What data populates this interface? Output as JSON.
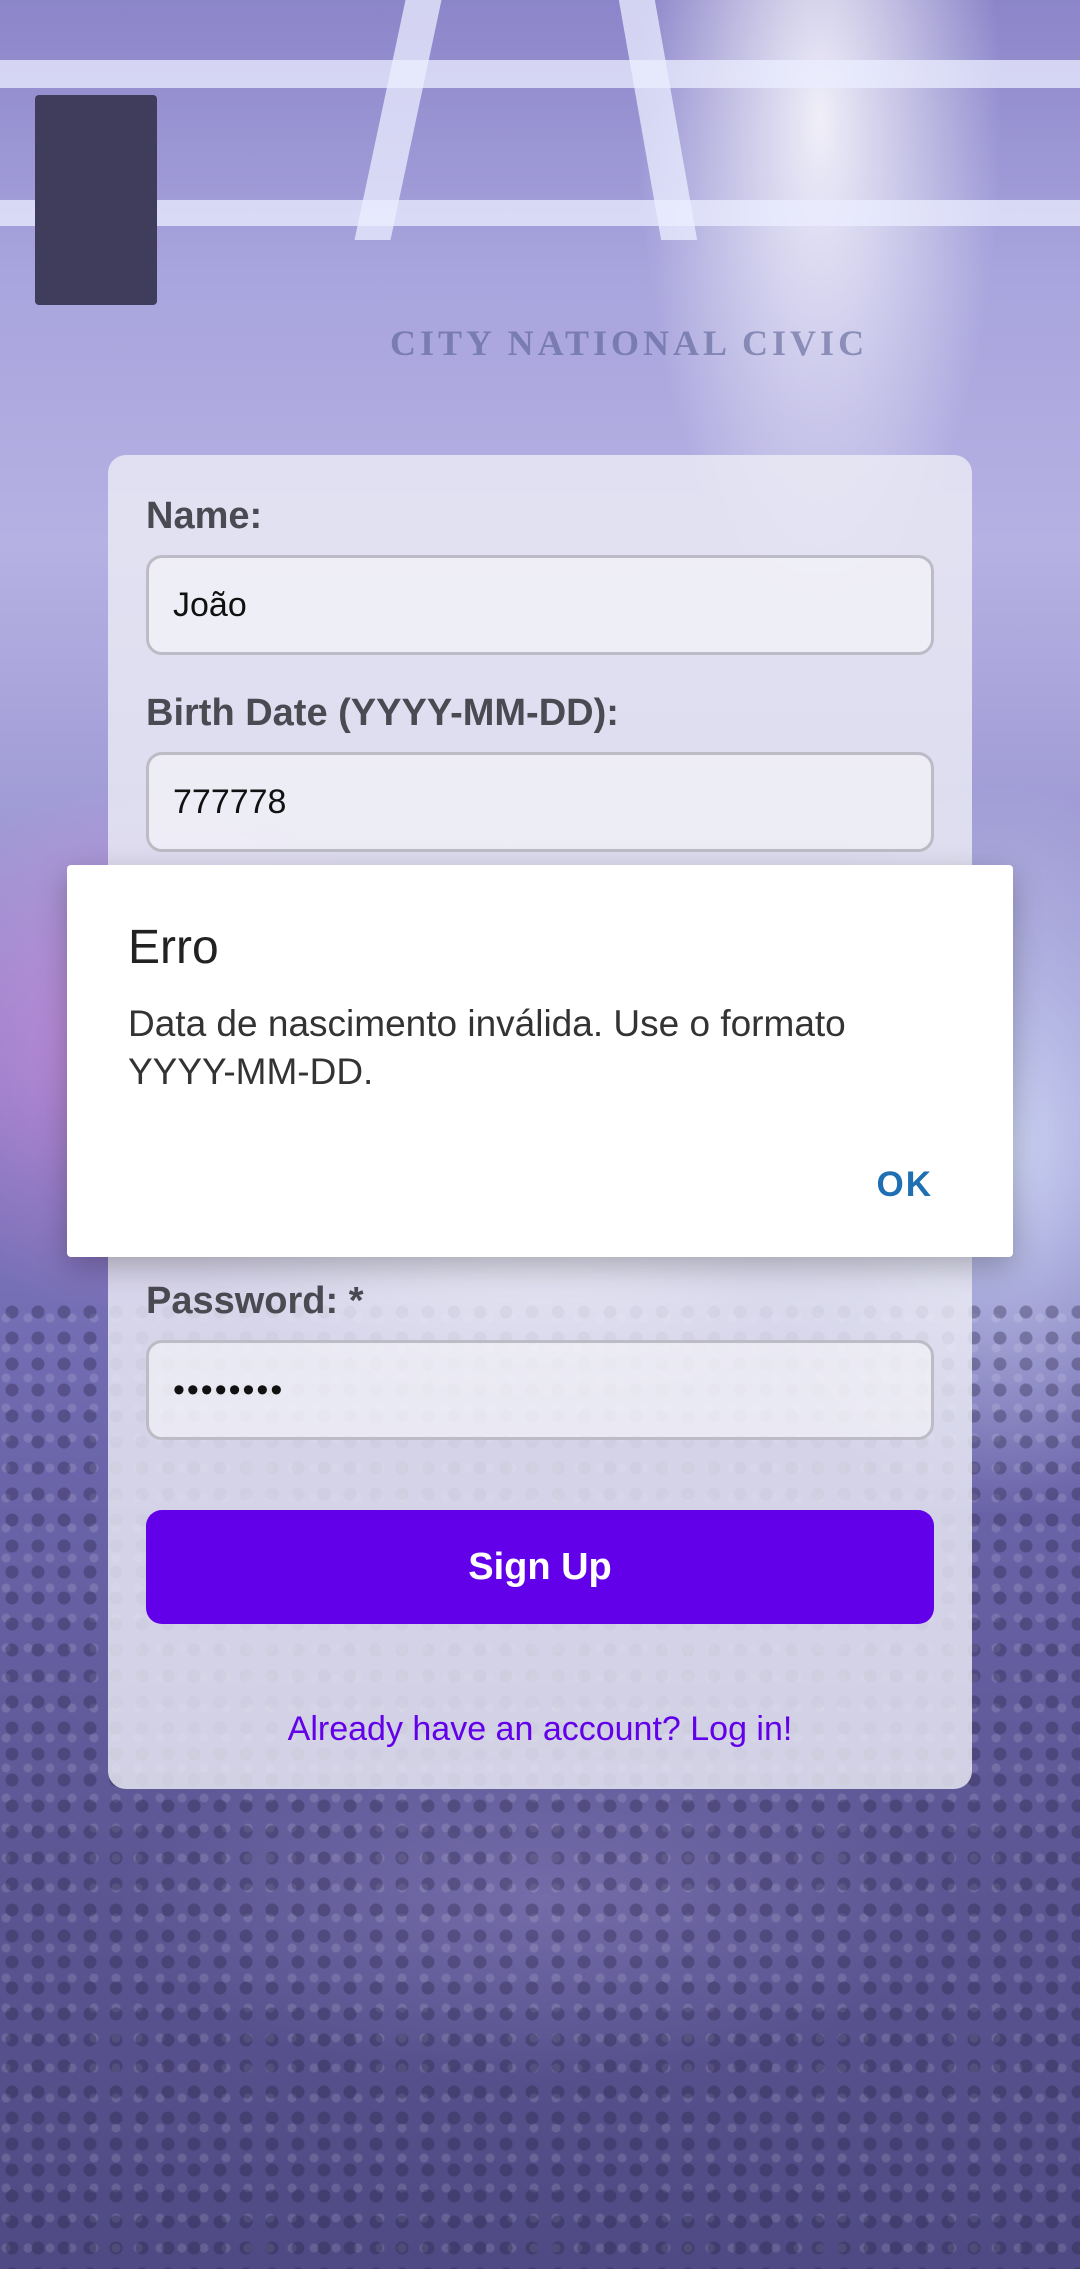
{
  "background": {
    "venue_sign": "CITY NATIONAL CIVIC"
  },
  "form": {
    "name_label": "Name:",
    "name_value": "João",
    "birth_label": "Birth Date (YYYY-MM-DD):",
    "birth_value": "777778",
    "password_label": "Password: *",
    "password_value": "••••••••",
    "signup_button": "Sign Up",
    "login_link": "Already have an account? Log in!"
  },
  "dialog": {
    "title": "Erro",
    "message": "Data de nascimento inválida. Use o formato YYYY-MM-DD.",
    "ok_button": "OK"
  },
  "colors": {
    "accent": "#6200ea",
    "dialog_button": "#1f6fb2"
  }
}
